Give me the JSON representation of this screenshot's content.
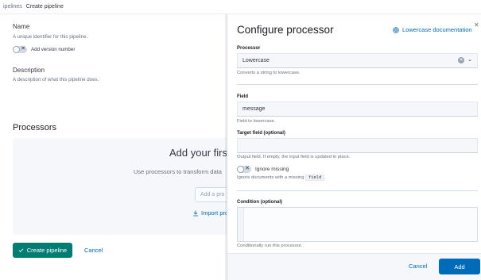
{
  "breadcrumbs": [
    "ipelines",
    "Create pipeline"
  ],
  "page": {
    "name_label": "Name",
    "name_help": "A unique identifier for this pipeline.",
    "version_toggle_label": "Add version number",
    "description_label": "Description",
    "description_help": "A description of what this pipeline does.",
    "processors_title": "Processors",
    "empty_title": "Add your first",
    "empty_body": "Use processors to transform data",
    "add_input_placeholder": "Add a pro",
    "import_link": "Import pro",
    "create_button": "Create pipeline",
    "cancel_button": "Cancel"
  },
  "flyout": {
    "title": "Configure processor",
    "doc_link": "Lowercase documentation",
    "processor_label": "Processor",
    "processor_value": "Lowercase",
    "processor_help": "Converts a string to lowercase.",
    "field_label": "Field",
    "field_value": "message",
    "field_help": "Field to lowercase.",
    "target_label": "Target field (optional)",
    "target_help": "Output field. If empty, the input field is updated in place.",
    "ignore_missing_label": "Ignore missing",
    "ignore_missing_help_prefix": "Ignore documents with a missing",
    "ignore_missing_help_code": "field",
    "ignore_missing_help_suffix": ".",
    "condition_label": "Condition (optional)",
    "condition_help": "Conditionally run this processor.",
    "cancel_button": "Cancel",
    "add_button": "Add"
  },
  "icons": {
    "close": "close-icon",
    "doc": "documentation-icon",
    "check": "check-icon",
    "import": "import-icon",
    "clear": "clear-icon",
    "chevron": "chevron-down-icon"
  },
  "colors": {
    "primary": "#006bb8",
    "success": "#017d73",
    "text": "#343741",
    "subdued": "#69707d"
  }
}
